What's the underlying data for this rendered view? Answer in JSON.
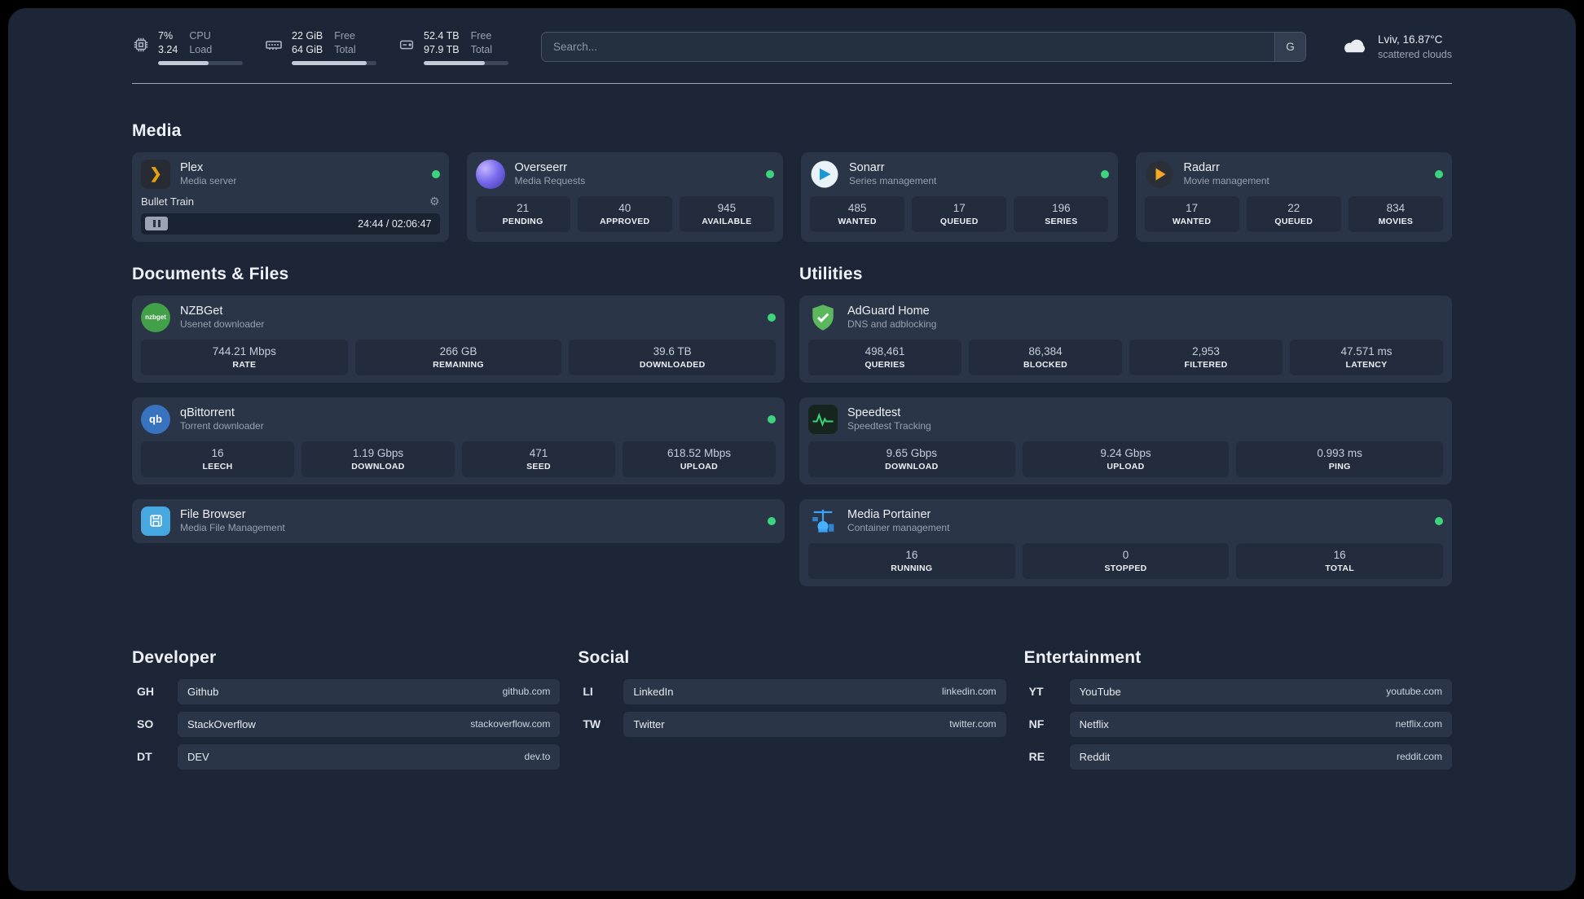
{
  "header": {
    "cpu": {
      "value": "7%",
      "sub": "3.24",
      "label1": "CPU",
      "label2": "Load",
      "progress": 60
    },
    "memory": {
      "value": "22 GiB",
      "sub": "64 GiB",
      "label1": "Free",
      "label2": "Total",
      "progress": 88
    },
    "disk": {
      "value": "52.4 TB",
      "sub": "97.9 TB",
      "label1": "Free",
      "label2": "Total",
      "progress": 72
    },
    "search": {
      "placeholder": "Search...",
      "button_label": "G"
    },
    "weather": {
      "icon": "cloud-icon",
      "location": "Lviv, 16.87°C",
      "condition": "scattered clouds"
    }
  },
  "sections": {
    "media": {
      "title": "Media",
      "cards": [
        {
          "name": "Plex",
          "desc": "Media server",
          "icon": "plex-icon",
          "status": "online",
          "player": {
            "track": "Bullet Train",
            "time": "24:44 / 02:06:47"
          }
        },
        {
          "name": "Overseerr",
          "desc": "Media Requests",
          "icon": "overseerr-icon",
          "status": "online",
          "stats": [
            {
              "value": "21",
              "label": "PENDING"
            },
            {
              "value": "40",
              "label": "APPROVED"
            },
            {
              "value": "945",
              "label": "AVAILABLE"
            }
          ]
        },
        {
          "name": "Sonarr",
          "desc": "Series management",
          "icon": "sonarr-icon",
          "status": "online",
          "stats": [
            {
              "value": "485",
              "label": "WANTED"
            },
            {
              "value": "17",
              "label": "QUEUED"
            },
            {
              "value": "196",
              "label": "SERIES"
            }
          ]
        },
        {
          "name": "Radarr",
          "desc": "Movie management",
          "icon": "radarr-icon",
          "status": "online",
          "stats": [
            {
              "value": "17",
              "label": "WANTED"
            },
            {
              "value": "22",
              "label": "QUEUED"
            },
            {
              "value": "834",
              "label": "MOVIES"
            }
          ]
        }
      ]
    },
    "documents": {
      "title": "Documents & Files",
      "cards": [
        {
          "name": "NZBGet",
          "desc": "Usenet downloader",
          "icon": "nzbget-icon",
          "status": "online",
          "stats": [
            {
              "value": "744.21 Mbps",
              "label": "RATE"
            },
            {
              "value": "266 GB",
              "label": "REMAINING"
            },
            {
              "value": "39.6 TB",
              "label": "DOWNLOADED"
            }
          ]
        },
        {
          "name": "qBittorrent",
          "desc": "Torrent downloader",
          "icon": "qbittorrent-icon",
          "status": "online",
          "stats": [
            {
              "value": "16",
              "label": "LEECH"
            },
            {
              "value": "1.19 Gbps",
              "label": "DOWNLOAD"
            },
            {
              "value": "471",
              "label": "SEED"
            },
            {
              "value": "618.52 Mbps",
              "label": "UPLOAD"
            }
          ]
        },
        {
          "name": "File Browser",
          "desc": "Media File Management",
          "icon": "filebrowser-icon",
          "status": "online"
        }
      ]
    },
    "utilities": {
      "title": "Utilities",
      "cards": [
        {
          "name": "AdGuard Home",
          "desc": "DNS and adblocking",
          "icon": "adguard-icon",
          "stats": [
            {
              "value": "498,461",
              "label": "QUERIES"
            },
            {
              "value": "86,384",
              "label": "BLOCKED"
            },
            {
              "value": "2,953",
              "label": "FILTERED"
            },
            {
              "value": "47.571 ms",
              "label": "LATENCY"
            }
          ]
        },
        {
          "name": "Speedtest",
          "desc": "Speedtest Tracking",
          "icon": "speedtest-icon",
          "stats": [
            {
              "value": "9.65 Gbps",
              "label": "DOWNLOAD"
            },
            {
              "value": "9.24 Gbps",
              "label": "UPLOAD"
            },
            {
              "value": "0.993 ms",
              "label": "PING"
            }
          ]
        },
        {
          "name": "Media Portainer",
          "desc": "Container management",
          "icon": "portainer-icon",
          "status": "online",
          "stats": [
            {
              "value": "16",
              "label": "RUNNING"
            },
            {
              "value": "0",
              "label": "STOPPED"
            },
            {
              "value": "16",
              "label": "TOTAL"
            }
          ]
        }
      ]
    },
    "bookmarks": [
      {
        "title": "Developer",
        "items": [
          {
            "abbr": "GH",
            "name": "Github",
            "url": "github.com"
          },
          {
            "abbr": "SO",
            "name": "StackOverflow",
            "url": "stackoverflow.com"
          },
          {
            "abbr": "DT",
            "name": "DEV",
            "url": "dev.to"
          }
        ]
      },
      {
        "title": "Social",
        "items": [
          {
            "abbr": "LI",
            "name": "LinkedIn",
            "url": "linkedin.com"
          },
          {
            "abbr": "TW",
            "name": "Twitter",
            "url": "twitter.com"
          }
        ]
      },
      {
        "title": "Entertainment",
        "items": [
          {
            "abbr": "YT",
            "name": "YouTube",
            "url": "youtube.com"
          },
          {
            "abbr": "NF",
            "name": "Netflix",
            "url": "netflix.com"
          },
          {
            "abbr": "RE",
            "name": "Reddit",
            "url": "reddit.com"
          }
        ]
      }
    ]
  }
}
